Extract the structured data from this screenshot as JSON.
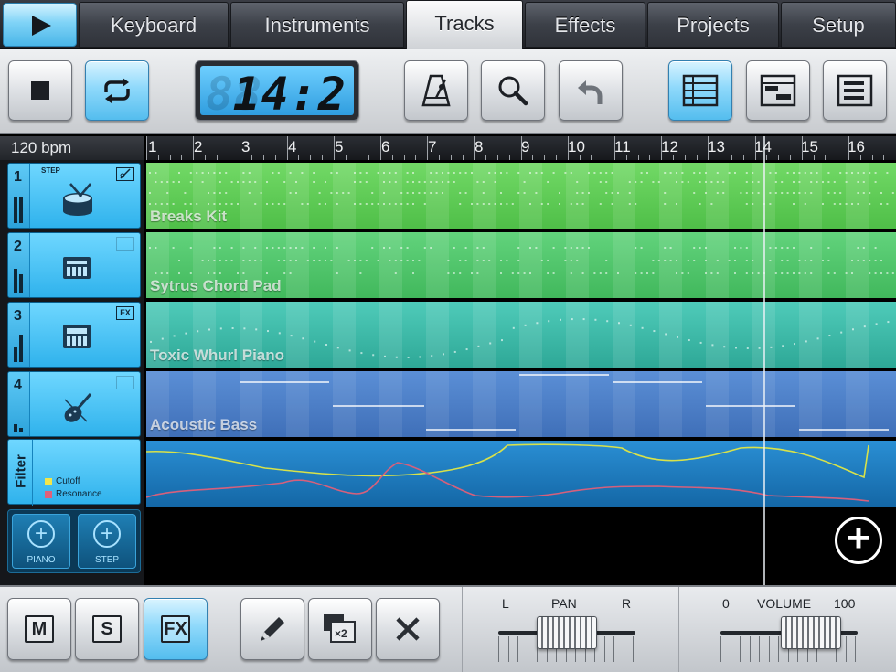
{
  "tabs": [
    {
      "label": "Keyboard"
    },
    {
      "label": "Instruments"
    },
    {
      "label": "Tracks"
    },
    {
      "label": "Effects"
    },
    {
      "label": "Projects"
    },
    {
      "label": "Setup"
    }
  ],
  "active_tab": "Tracks",
  "transport": {
    "position_display": "14:2",
    "display_ghost": "88"
  },
  "bpm_label": "120 bpm",
  "ruler": [
    "1",
    "2",
    "3",
    "4",
    "5",
    "6",
    "7",
    "8",
    "9",
    "10",
    "11",
    "12",
    "13",
    "14",
    "15",
    "16"
  ],
  "tracks": [
    {
      "number": "1",
      "tag": "STEP",
      "name": "Breaks Kit",
      "icon": "drum-icon",
      "color": "#5fcf55",
      "fx": false
    },
    {
      "number": "2",
      "tag": "",
      "name": "Sytrus Chord Pad",
      "icon": "pad-icon",
      "color": "#4ec46f",
      "fx": false
    },
    {
      "number": "3",
      "tag": "",
      "name": "Toxic Whurl Piano",
      "icon": "keyboard-icon",
      "color": "#39b8a7",
      "fx": true,
      "fx_label": "FX"
    },
    {
      "number": "4",
      "tag": "",
      "name": "Acoustic Bass",
      "icon": "violin-icon",
      "color": "#4d82c9",
      "fx": false
    }
  ],
  "filter": {
    "label": "Filter",
    "legend": [
      {
        "name": "Cutoff",
        "color": "#f2e64a"
      },
      {
        "name": "Resonance",
        "color": "#e0607a"
      }
    ]
  },
  "add_buttons": [
    {
      "label": "PIANO"
    },
    {
      "label": "STEP"
    }
  ],
  "bottom": {
    "mute_label": "M",
    "solo_label": "S",
    "fx_label": "FX",
    "clone_label": "×2",
    "pan": {
      "title": "PAN",
      "left": "L",
      "right": "R",
      "value": 0.5
    },
    "volume": {
      "title": "VOLUME",
      "min": "0",
      "max": "100",
      "value": 78
    }
  },
  "colors": {
    "accent": "#54bdee",
    "filter_lane": "#1779bd"
  }
}
